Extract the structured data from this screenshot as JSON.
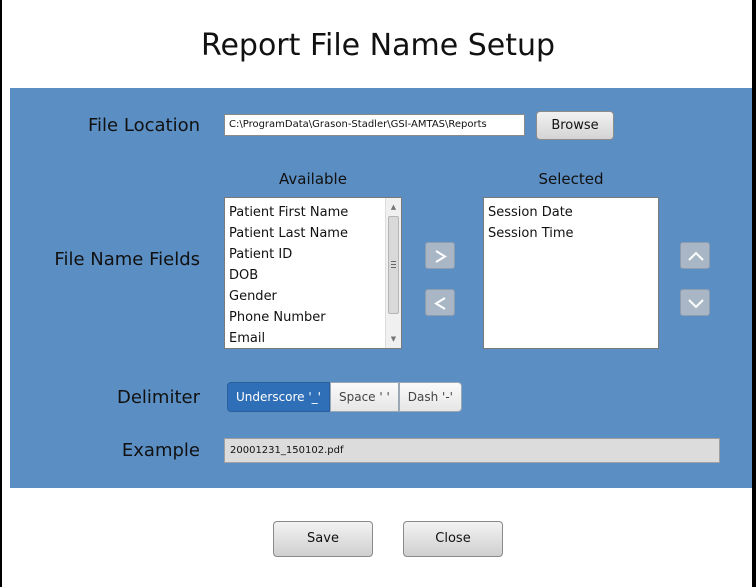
{
  "title": "Report File Name Setup",
  "labels": {
    "file_location": "File Location",
    "file_name_fields": "File Name Fields",
    "delimiter": "Delimiter",
    "example": "Example"
  },
  "file_location": {
    "path": "C:\\ProgramData\\Grason-Stadler\\GSI-AMTAS\\Reports",
    "browse_label": "Browse"
  },
  "available": {
    "header": "Available",
    "items": [
      "Patient First Name",
      "Patient Last Name",
      "Patient ID",
      "DOB",
      "Gender",
      "Phone Number",
      "Email"
    ]
  },
  "selected": {
    "header": "Selected",
    "items": [
      "Session Date",
      "Session Time"
    ]
  },
  "delimiter": {
    "options": [
      "Underscore '_'",
      "Space ' '",
      "Dash '-'"
    ],
    "selected": "Underscore '_'"
  },
  "example": {
    "value": "20001231_150102.pdf"
  },
  "buttons": {
    "save": "Save",
    "close": "Close"
  },
  "colors": {
    "panel": "#5b8ec3",
    "accent": "#2e6fb7"
  }
}
